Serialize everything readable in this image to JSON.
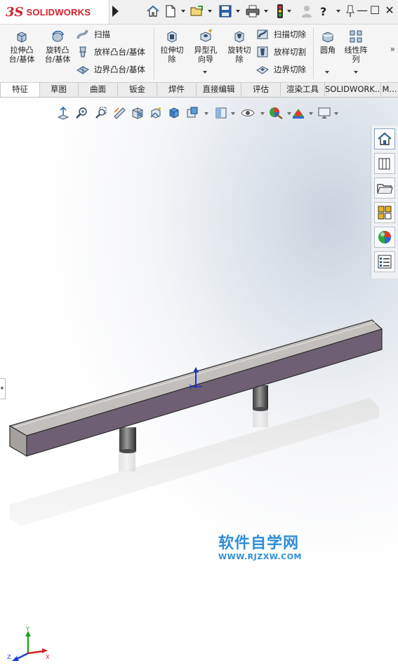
{
  "app": {
    "brand_prefix": "3S",
    "brand_name": "SOLIDWORKS",
    "title_icons": [
      "home-icon",
      "new-document-icon",
      "open-icon",
      "save-icon",
      "print-icon",
      "traffic-light-icon",
      "user-icon",
      "help-icon",
      "pin-icon"
    ],
    "window_controls": {
      "minimize": "—",
      "restore": "☐",
      "close": "✕"
    },
    "help_label": "?"
  },
  "ribbon": {
    "extrude_boss": "拉伸凸\n台/基体",
    "revolve_boss": "旋转凸\n台/基体",
    "sweep": "扫描",
    "loft_boss": "放样凸台/基体",
    "boundary_boss": "边界凸台/基体",
    "extrude_cut": "拉伸切\n除",
    "hole_wizard": "异型孔\n向导",
    "revolve_cut": "旋转切\n除",
    "sweep_cut": "扫描切除",
    "loft_cut": "放样切割",
    "boundary_cut": "边界切除",
    "fillet": "圆角",
    "linear_pattern": "线性阵\n列",
    "more": "»"
  },
  "tabs": [
    {
      "label": "特征",
      "active": true
    },
    {
      "label": "草图",
      "active": false
    },
    {
      "label": "曲面",
      "active": false
    },
    {
      "label": "钣金",
      "active": false
    },
    {
      "label": "焊件",
      "active": false
    },
    {
      "label": "直接编辑",
      "active": false
    },
    {
      "label": "评估",
      "active": false
    },
    {
      "label": "渲染工具",
      "active": false
    },
    {
      "label": "SOLIDWORK...",
      "active": false
    },
    {
      "label": "M...",
      "active": false
    }
  ],
  "heads_up_icons": [
    "zoom-to-fit-icon",
    "zoom-area-icon",
    "previous-view-icon",
    "section-view-icon",
    "dynamic-annotation-icon",
    "view-orientation-icon",
    "display-style-icon",
    "hide-show-icon",
    "edit-appearance-icon",
    "apply-scene-icon",
    "view-settings-icon"
  ],
  "task_pane": [
    "resources-home-icon",
    "design-library-icon",
    "file-explorer-icon",
    "view-palette-icon",
    "appearances-icon",
    "custom-properties-icon"
  ],
  "watermark": {
    "main": "软件自学网",
    "url": "WWW.RJZXW.COM"
  },
  "colors": {
    "brand_red": "#d0202a",
    "model_side": "#6e6072",
    "model_top": "#c2bfbc",
    "watermark_blue": "#2e8ed8",
    "axis_red": "#d62020",
    "axis_green": "#1ea21e",
    "axis_blue": "#1f3fd6"
  },
  "triad": {
    "x": "X",
    "y": "Y",
    "z": "Z"
  }
}
